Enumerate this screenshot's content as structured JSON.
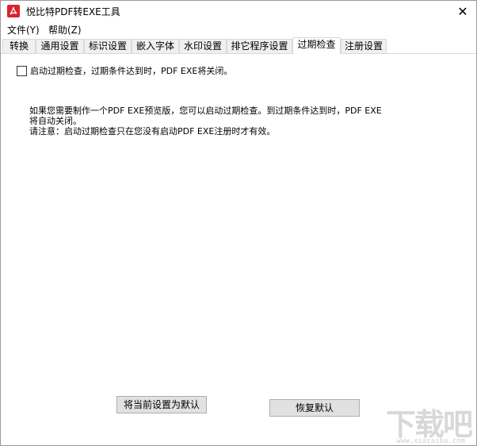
{
  "window": {
    "title": "悦比特PDF转EXE工具",
    "close_glyph": "✕"
  },
  "menu": [
    "文件(Y)",
    "帮助(Z)"
  ],
  "tabs": [
    {
      "label": "转换",
      "active": false
    },
    {
      "label": "通用设置",
      "active": false
    },
    {
      "label": "标识设置",
      "active": false
    },
    {
      "label": "嵌入字体",
      "active": false
    },
    {
      "label": "水印设置",
      "active": false
    },
    {
      "label": "排它程序设置",
      "active": false
    },
    {
      "label": "过期检查",
      "active": true
    },
    {
      "label": "注册设置",
      "active": false
    }
  ],
  "expiry": {
    "checkbox_label": "启动过期检查，过期条件达到时，PDF EXE将关闭。",
    "checked": false,
    "info_line1": "如果您需要制作一个PDF EXE预览版，您可以启动过期检查。到过期条件达到时，PDF EXE将自动关闭。",
    "info_line2": "请注意：启动过期检查只在您没有启动PDF EXE注册时才有效。"
  },
  "buttons": {
    "set_default": "将当前设置为默认",
    "restore_default": "恢复默认"
  },
  "watermark": {
    "text": "下载吧",
    "sub": "www.xiazaiba.com"
  },
  "colors": {
    "accent": "#d9232d",
    "tab_border": "#d9d9d9",
    "button_bg": "#e1e1e1"
  }
}
